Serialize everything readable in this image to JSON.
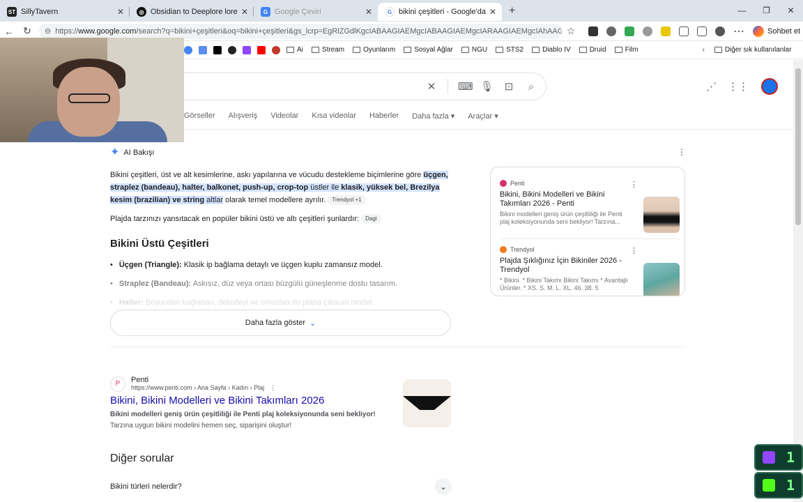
{
  "tabs": [
    {
      "label": "SillyTavern",
      "color": "#222"
    },
    {
      "label": "Obsidian to Deeplore lore convers",
      "color": "#111"
    },
    {
      "label": "Google Çeviri",
      "color": "#4285f4"
    },
    {
      "label": "bikini çeşitleri - Google'da Ara",
      "color": "#4285f4"
    }
  ],
  "address": {
    "prefix": "https://",
    "host": "www.google.com",
    "path": "/search?q=bikini+çeşitleri&oq=bikini+çeşitleri&gs_lcrp=EgRlZGdlKgcIABAAGIAEMgcIABAAGIAEMgcIARAAGIAEMgcIAhAAGIAEMgcI..."
  },
  "copilot_label": "Sohbet et",
  "bookmarks": [
    "Ai",
    "Stream",
    "Oyunlarım",
    "Sosyal Ağlar",
    "NGU",
    "STS2",
    "Diablo IV",
    "Druid",
    "Film"
  ],
  "bookmarks_other": "Diğer sık kullanılanlar",
  "search_tabs": [
    "Görseller",
    "Alışveriş",
    "Videolar",
    "Kısa videolar",
    "Haberler",
    "Daha fazla ▾",
    "Araçlar ▾"
  ],
  "ai": {
    "heading": "AI Bakışı",
    "p1_a": "Bikini çeşitleri, üst ve alt kesimlerine, askı yapılarına ve vücudu destekleme biçimlerine göre",
    "p1_b": "üçgen, straplez (bandeau), halter, balkonet, push-up, crop-top",
    "p1_c": " üstler ile ",
    "p1_d": "klasik, yüksek bel, Brezilya kesim (brazilian) ve string",
    "p1_e": " altlar",
    "p1_f": " olarak temel modellere ayrılır.",
    "chip1": "Trendyol +1",
    "p2": "Plajda tarzınızı yansıtacak en popüler bikini üstü ve altı çeşitleri şunlardır:",
    "chip2": "Dagi",
    "h3": "Bikini Üstü Çeşitleri",
    "items": [
      {
        "b": "Üçgen (Triangle):",
        "t": " Klasik ip bağlama detaylı ve üçgen kuplu zamansız model."
      },
      {
        "b": "Straplez (Bandeau):",
        "t": " Askısız, düz veya ortası büzgülü güneşlenme dostu tasarım."
      },
      {
        "b": "Halter:",
        "t": " Boyundan bağlanan, dekolteyi ve omuzları ön plana çıkaran model."
      }
    ],
    "more": "Daha fazla göster"
  },
  "side_cards": [
    {
      "source": "Penti",
      "title": "Bikini, Bikini Modelleri ve Bikini Takımları 2026 - Penti",
      "snippet": "Bikini modelleri geniş ürün çeşitliliği ile Penti plaj koleksiyonunda seni bekliyor! Tarzına...",
      "color": "#d6336c"
    },
    {
      "source": "Trendyol",
      "title": "Plajda Şıklığınız İçin Bikiniler 2026 - Trendyol",
      "snippet": "* Bikini. * Bikini Takımı Bikini Takımı * Avantajlı Ürünler. * XS. S. M. L. XL. 46. 38. 5",
      "color": "#f27a1a"
    }
  ],
  "result": {
    "site": "Penti",
    "url": "https://www.penti.com › Ana Sayfa › Kadın › Plaj",
    "title": "Bikini, Bikini Modelleri ve Bikini Takımları 2026",
    "snippet_b": "Bikini modelleri geniş ürün çeşitliliği ile Penti plaj koleksiyonunda seni bekliyor!",
    "snippet": "Tarzına uygun bikini modelini hemen seç, siparişini oluştur!"
  },
  "others_heading": "Diğer sorular",
  "question": "Bikini türleri nelerdir?",
  "counters": [
    {
      "value": "1",
      "color": "#9146ff"
    },
    {
      "value": "1",
      "color": "#53fc18"
    }
  ]
}
